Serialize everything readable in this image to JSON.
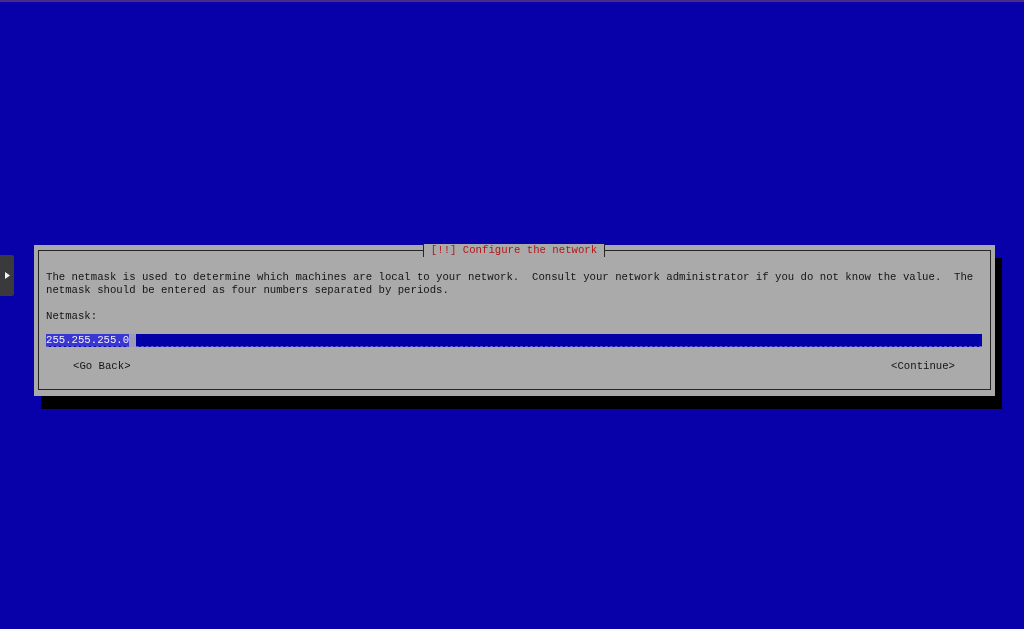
{
  "dialog": {
    "title": "[!!] Configure the network",
    "description": "The netmask is used to determine which machines are local to your network.  Consult your network administrator if you do not know the value.  The netmask should be entered as four numbers separated by periods.",
    "field": {
      "label": "Netmask:",
      "value": "255.255.255.0",
      "focused": true
    },
    "buttons": [
      {
        "label": "<Go Back>"
      },
      {
        "label": "<Continue>"
      }
    ]
  }
}
